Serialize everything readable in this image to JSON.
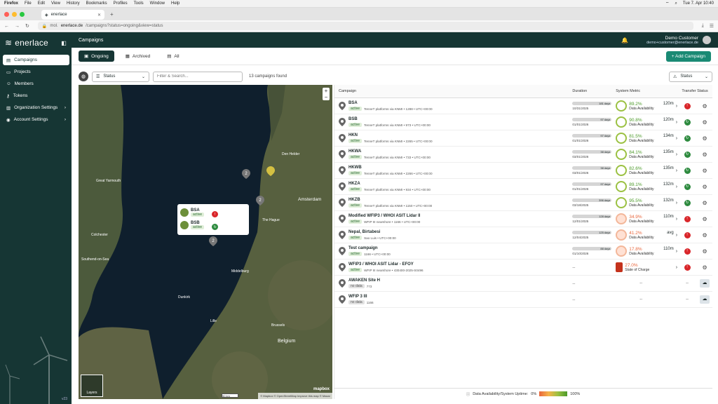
{
  "os": {
    "app": "Firefox",
    "menu": [
      "File",
      "Edit",
      "View",
      "History",
      "Bookmarks",
      "Profiles",
      "Tools",
      "Window",
      "Help"
    ],
    "clock": "Tue 7. Apr 10:40"
  },
  "browser": {
    "tab_title": "enerlace",
    "url_prefix": "mol.",
    "url_host": "enerlace.de",
    "url_path": "/campaigns?status=ongoing&view=status"
  },
  "sidebar": {
    "brand": "enerlace",
    "items": [
      {
        "label": "Campaigns"
      },
      {
        "label": "Projects"
      },
      {
        "label": "Members"
      },
      {
        "label": "Tokens"
      },
      {
        "label": "Organization Settings"
      },
      {
        "label": "Account Settings"
      }
    ],
    "version": "v23"
  },
  "topbar": {
    "title": "Campaigns",
    "user_name": "Demo Customer",
    "user_email": "demo+customer@enerlace.de"
  },
  "tabs": [
    {
      "label": "Ongoing"
    },
    {
      "label": "Archived"
    },
    {
      "label": "All"
    }
  ],
  "add_button": "+ Add Campaign",
  "filters": {
    "status_label": "Status",
    "search_placeholder": "Filter & Search...",
    "found": "13 campaigns found",
    "right_status": "Status"
  },
  "map": {
    "cities": [
      "Great Yarmouth",
      "Colchester",
      "Southend-on-Sea",
      "Amsterdam",
      "The Hague",
      "Den Helder",
      "Middelburg",
      "Dunkirk",
      "Brussels",
      "Belgium",
      "Lille"
    ],
    "clusters": [
      "2",
      "2",
      "2"
    ],
    "popup": [
      {
        "name": "BSA",
        "status": "active"
      },
      {
        "name": "BSB",
        "status": "active"
      }
    ],
    "layers": "Layers",
    "attribution": "© Mapbox © OpenStreetMap Improve this map © Maxar",
    "scale": "50 km",
    "mapbox": "mapbox"
  },
  "table": {
    "headers": {
      "campaign": "Campaign",
      "duration": "Duration",
      "metric": "System Metric",
      "transfer": "Transfer Status"
    },
    "rows": [
      {
        "name": "BSA",
        "status": "active",
        "meta": "TenneT platforms via KNMI • 1288 • UTC+00:00",
        "days": "181 days",
        "date": "10/31/2025",
        "pct": "89.2%",
        "height": "120m",
        "metric": "Data Availability",
        "transfer": "red"
      },
      {
        "name": "BSB",
        "status": "active",
        "meta": "TenneT platforms via KNMI • 973 • UTC+00:00",
        "days": "97 days",
        "date": "01/01/2026",
        "pct": "90.8%",
        "height": "120m",
        "metric": "Data Availability",
        "transfer": "green"
      },
      {
        "name": "HKN",
        "status": "active",
        "meta": "TenneT platforms via KNMI • 2265 • UTC+00:00",
        "days": "97 days",
        "date": "01/01/2026",
        "pct": "81.5%",
        "height": "134m",
        "metric": "Data Availability",
        "transfer": "green"
      },
      {
        "name": "HKWA",
        "status": "active",
        "meta": "TenneT platforms via KNMI • 733 • UTC+00:00",
        "days": "38 days",
        "date": "03/01/2026",
        "pct": "84.1%",
        "height": "135m",
        "metric": "Data Availability",
        "transfer": "green"
      },
      {
        "name": "HKWB",
        "status": "active",
        "meta": "TenneT platforms via KNMI • 2266 • UTC+00:00",
        "days": "38 days",
        "date": "03/01/2026",
        "pct": "82.6%",
        "height": "135m",
        "metric": "Data Availability",
        "transfer": "green"
      },
      {
        "name": "HKZA",
        "status": "active",
        "meta": "TenneT platforms via KNMI • 934 • UTC+00:00",
        "days": "97 days",
        "date": "01/01/2026",
        "pct": "89.1%",
        "height": "132m",
        "metric": "Data Availability",
        "transfer": "green"
      },
      {
        "name": "HKZB",
        "status": "active",
        "meta": "TenneT platforms via KNMI • 1150 • UTC+00:00",
        "days": "396 days",
        "date": "03/18/2025",
        "pct": "95.5%",
        "height": "132m",
        "metric": "Data Availability",
        "transfer": "green"
      },
      {
        "name": "Modified WFIP3 / WHOI ASIT Lidar II",
        "status": "active",
        "meta": "WFIP III nearshore • 1166 • UTC+00:00",
        "days": "128 days",
        "date": "12/01/2025",
        "pct": "34.9%",
        "height": "110m",
        "metric": "Data Availability",
        "transfer": "red"
      },
      {
        "name": "Nepal, Birtabesi",
        "status": "active",
        "meta": "Sao Luis • UTC+00:00",
        "days": "125 days",
        "date": "12/04/2025",
        "pct": "41.2%",
        "height": "avg",
        "metric": "Data Availability",
        "transfer": "red"
      },
      {
        "name": "Test campaign",
        "status": "active",
        "meta": "1166 • UTC+00:00",
        "days": "88 days",
        "date": "01/10/2026",
        "pct": "17.8%",
        "height": "110m",
        "metric": "Data Availability",
        "transfer": "red"
      },
      {
        "name": "WFIP3 / WHOI ASIT Lidar - EFOY",
        "status": "active",
        "meta": "WFIP III nearshore • 430400-2025-S0496",
        "days": "",
        "date": "",
        "pct": "27.0%",
        "height": "",
        "metric": "State of Charge",
        "transfer": "red"
      },
      {
        "name": "AWAKEN Site H",
        "status": "no data",
        "meta": "773",
        "days": "",
        "date": "",
        "pct": "",
        "height": "",
        "metric": "",
        "transfer": "cloud"
      },
      {
        "name": "WFIP 3 III",
        "status": "no data",
        "meta": "1166",
        "days": "",
        "date": "",
        "pct": "",
        "height": "",
        "metric": "",
        "transfer": "cloud"
      }
    ]
  },
  "footer": {
    "label": "Data Availability/System Uptime:",
    "min": "0%",
    "max": "100%"
  }
}
